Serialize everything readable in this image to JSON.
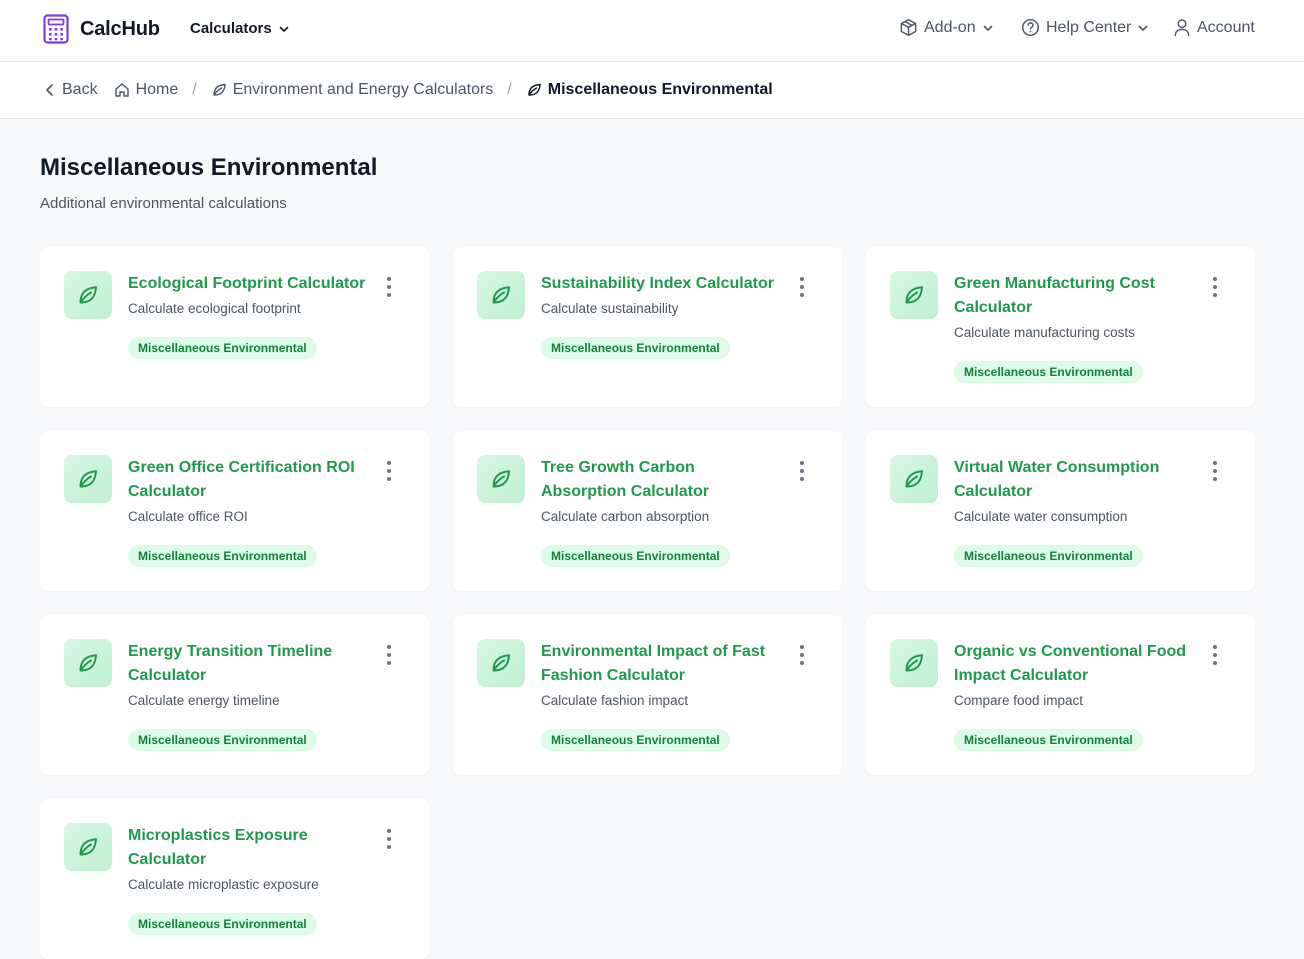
{
  "header": {
    "brand": "CalcHub",
    "calculators_menu": "Calculators",
    "addon_menu": "Add-on",
    "help_menu": "Help Center",
    "account_menu": "Account",
    "brand_color": "#7c3aed"
  },
  "breadcrumb": {
    "back": "Back",
    "home": "Home",
    "parent": "Environment and Energy Calculators",
    "current": "Miscellaneous Environmental"
  },
  "page": {
    "title": "Miscellaneous Environmental",
    "subtitle": "Additional environmental calculations"
  },
  "cards": [
    {
      "title": "Ecological Footprint Calculator",
      "description": "Calculate ecological footprint",
      "tag": "Miscellaneous Environmental",
      "icon": "leaf-icon"
    },
    {
      "title": "Sustainability Index Calculator",
      "description": "Calculate sustainability",
      "tag": "Miscellaneous Environmental",
      "icon": "leaf-icon"
    },
    {
      "title": "Green Manufacturing Cost Calculator",
      "description": "Calculate manufacturing costs",
      "tag": "Miscellaneous Environmental",
      "icon": "leaf-icon"
    },
    {
      "title": "Green Office Certification ROI Calculator",
      "description": "Calculate office ROI",
      "tag": "Miscellaneous Environmental",
      "icon": "leaf-icon"
    },
    {
      "title": "Tree Growth Carbon Absorption Calculator",
      "description": "Calculate carbon absorption",
      "tag": "Miscellaneous Environmental",
      "icon": "leaf-icon"
    },
    {
      "title": "Virtual Water Consumption Calculator",
      "description": "Calculate water consumption",
      "tag": "Miscellaneous Environmental",
      "icon": "leaf-icon"
    },
    {
      "title": "Energy Transition Timeline Calculator",
      "description": "Calculate energy timeline",
      "tag": "Miscellaneous Environmental",
      "icon": "leaf-icon"
    },
    {
      "title": "Environmental Impact of Fast Fashion Calculator",
      "description": "Calculate fashion impact",
      "tag": "Miscellaneous Environmental",
      "icon": "leaf-icon"
    },
    {
      "title": "Organic vs Conventional Food Impact Calculator",
      "description": "Compare food impact",
      "tag": "Miscellaneous Environmental",
      "icon": "leaf-icon"
    },
    {
      "title": "Microplastics Exposure Calculator",
      "description": "Calculate microplastic exposure",
      "tag": "Miscellaneous Environmental",
      "icon": "leaf-icon"
    }
  ],
  "colors": {
    "accent_green": "#1f9a4b",
    "tag_bg": "#dcfce7",
    "tag_text": "#15803d"
  }
}
